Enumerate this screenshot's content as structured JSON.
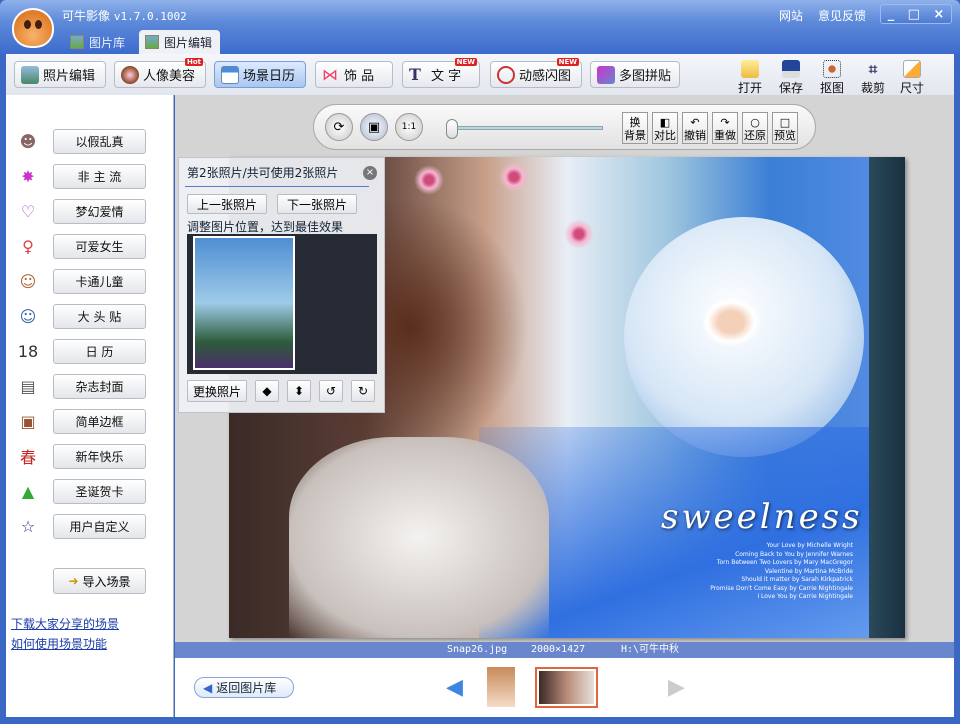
{
  "app": {
    "title": "可牛影像",
    "version": "v1.7.0.1002",
    "links": [
      "网站",
      "意见反馈"
    ],
    "window_buttons": [
      "_",
      "□",
      "×"
    ]
  },
  "tabs": [
    {
      "label": "图片库",
      "active": false
    },
    {
      "label": "图片编辑",
      "active": true
    }
  ],
  "toolbar": {
    "buttons": [
      {
        "label": "照片编辑",
        "icon": "photo-icon"
      },
      {
        "label": "人像美容",
        "icon": "portrait-icon",
        "badge": "Hot"
      },
      {
        "label": "场景日历",
        "icon": "calendar-icon",
        "active": true
      },
      {
        "label": "饰 品",
        "icon": "bow-icon"
      },
      {
        "label": "文 字",
        "icon": "text-icon",
        "badge": "NEW"
      },
      {
        "label": "动感闪图",
        "icon": "flash-icon",
        "badge": "NEW"
      },
      {
        "label": "多图拼贴",
        "icon": "collage-icon"
      }
    ],
    "tools": [
      {
        "label": "打开",
        "icon": "folder-icon"
      },
      {
        "label": "保存",
        "icon": "save-icon"
      },
      {
        "label": "抠图",
        "icon": "cutout-icon"
      },
      {
        "label": "裁剪",
        "icon": "crop-icon"
      },
      {
        "label": "尺寸",
        "icon": "resize-icon"
      }
    ]
  },
  "sidebar": {
    "items": [
      {
        "label": "以假乱真",
        "glyph": "☻"
      },
      {
        "label": "非 主 流",
        "glyph": "✸"
      },
      {
        "label": "梦幻爱情",
        "glyph": "♡"
      },
      {
        "label": "可爱女生",
        "glyph": "♀"
      },
      {
        "label": "卡通儿童",
        "glyph": "☺"
      },
      {
        "label": "大 头 贴",
        "glyph": "☺"
      },
      {
        "label": "日  历",
        "glyph": "18"
      },
      {
        "label": "杂志封面",
        "glyph": "▤"
      },
      {
        "label": "简单边框",
        "glyph": "▣"
      },
      {
        "label": "新年快乐",
        "glyph": "春"
      },
      {
        "label": "圣诞贺卡",
        "glyph": "▲"
      },
      {
        "label": "用户自定义",
        "glyph": "☆"
      }
    ],
    "import_label": "导入场景",
    "links": [
      "下载大家分享的场景",
      "如何使用场景功能"
    ]
  },
  "controls": {
    "boxes": [
      {
        "top": "换",
        "bottom": "背景"
      },
      {
        "top": "◧",
        "bottom": "对比"
      },
      {
        "top": "↶",
        "bottom": "撤销"
      },
      {
        "top": "↷",
        "bottom": "重做"
      },
      {
        "top": "○",
        "bottom": "还原"
      },
      {
        "top": "□",
        "bottom": "预览"
      }
    ],
    "zoom_level": 0,
    "one_to_one": "1:1"
  },
  "panel": {
    "title": "第2张照片/共可使用2张照片",
    "prev": "上一张照片",
    "next": "下一张照片",
    "hint": "调整图片位置，达到最佳效果",
    "replace": "更换照片",
    "close": "×"
  },
  "photo": {
    "title": "sweelness",
    "songs": [
      "Your Love by Michelle Wright",
      "Coming Back to You by Jennifer Warnes",
      "Torn Between Two Lovers by Mary MacGregor",
      "Valentine by Martina McBride",
      "Should it matter by Sarah Kirkpatrick",
      "Promise Don't Come Easy by Carrie Nightingale",
      "I Love You by Carrie Nightingale"
    ]
  },
  "status": {
    "filename": "Snap26.jpg",
    "dimensions": "2000×1427",
    "path": "H:\\可牛中秋"
  },
  "bottom": {
    "back_label": "返回图片库",
    "thumbnails_selected": 2,
    "thumbnails_count": 2
  }
}
